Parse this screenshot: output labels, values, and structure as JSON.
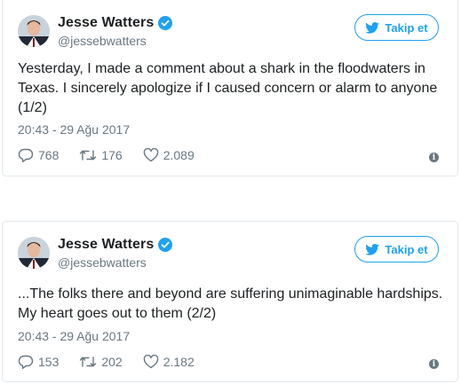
{
  "tweets": [
    {
      "author_name": "Jesse Watters",
      "handle": "@jessebwatters",
      "follow_label": "Takip et",
      "text": "Yesterday, I made a comment about a shark in the floodwaters in Texas. I sincerely apologize if I caused concern or alarm to anyone (1/2)",
      "timestamp": "20:43 - 29 Ağu 2017",
      "replies": "768",
      "retweets": "176",
      "likes": "2.089"
    },
    {
      "author_name": "Jesse Watters",
      "handle": "@jessebwatters",
      "follow_label": "Takip et",
      "text": "...The folks there and beyond are suffering unimaginable hardships. My heart goes out to them (2/2)",
      "timestamp": "20:43 - 29 Ağu 2017",
      "replies": "153",
      "retweets": "202",
      "likes": "2.182"
    }
  ],
  "colors": {
    "accent": "#1da1f2",
    "secondary_text": "#697882",
    "primary_text": "#1c2022",
    "border": "#e1e8ed"
  },
  "icons": [
    "verified-badge-icon",
    "twitter-bird-icon",
    "reply-icon",
    "retweet-icon",
    "like-icon",
    "info-icon"
  ]
}
